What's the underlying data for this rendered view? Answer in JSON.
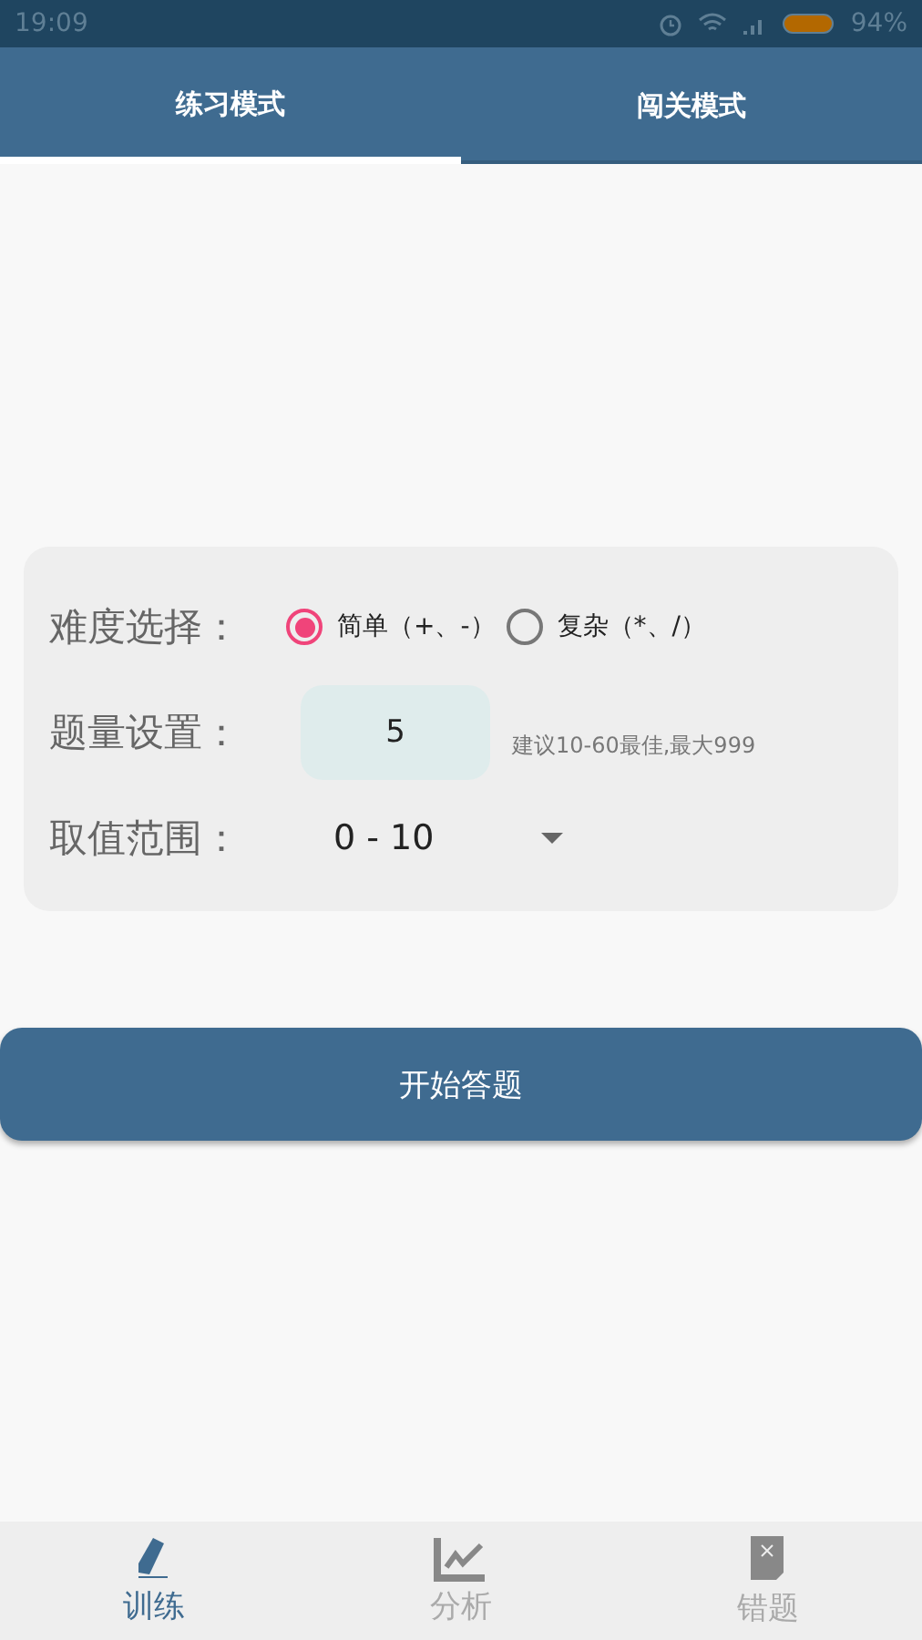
{
  "status_bar": {
    "time": "19:09",
    "battery": "94%"
  },
  "tabs": [
    {
      "label": "练习模式",
      "selected": true
    },
    {
      "label": "闯关模式",
      "selected": false
    }
  ],
  "settings": {
    "difficulty": {
      "label": "难度选择：",
      "options": [
        {
          "label": "简单（+、-）",
          "selected": true
        },
        {
          "label": "复杂（*、/）",
          "selected": false
        }
      ]
    },
    "count": {
      "label": "题量设置：",
      "value": "5",
      "hint": "建议10-60最佳,最大999"
    },
    "range": {
      "label": "取值范围：",
      "value": "0 - 10"
    }
  },
  "start_button": "开始答题",
  "bottom_nav": [
    {
      "label": "训练",
      "kind": "pen",
      "selected": true
    },
    {
      "label": "分析",
      "kind": "chart",
      "selected": false
    },
    {
      "label": "错题",
      "kind": "note",
      "selected": false
    }
  ]
}
